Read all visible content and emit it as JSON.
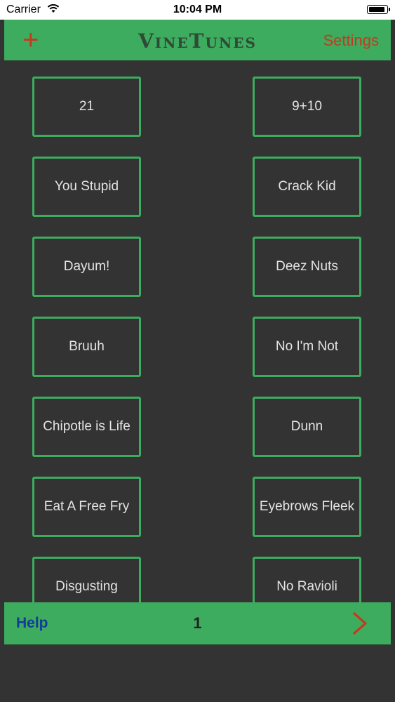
{
  "status_bar": {
    "carrier": "Carrier",
    "time": "10:04 PM"
  },
  "nav": {
    "add_label": "+",
    "title": "VineTunes",
    "settings_label": "Settings"
  },
  "sounds": [
    {
      "left": "21",
      "right": "9+10"
    },
    {
      "left": "You Stupid",
      "right": "Crack Kid"
    },
    {
      "left": "Dayum!",
      "right": "Deez Nuts"
    },
    {
      "left": "Bruuh",
      "right": "No I'm Not"
    },
    {
      "left": "Chipotle is Life",
      "right": "Dunn"
    },
    {
      "left": "Eat A Free Fry",
      "right": "Eyebrows Fleek"
    },
    {
      "left": "Disgusting",
      "right": "No Ravioli"
    }
  ],
  "footer": {
    "help_label": "Help",
    "page_number": "1",
    "next_icon": "chevron-right-icon"
  },
  "colors": {
    "bar_green": "#3dac5f",
    "background": "#333333",
    "accent_red": "#c43a1e",
    "help_blue": "#123b9a"
  }
}
